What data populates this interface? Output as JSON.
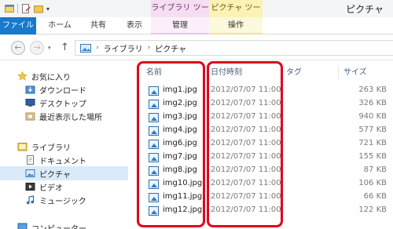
{
  "window": {
    "title": "ピクチャ"
  },
  "context_tabs": {
    "library_tools": "ライブラリ ツール",
    "picture_tools": "ピクチャ ツール"
  },
  "ribbon": {
    "file": "ファイル",
    "home": "ホーム",
    "share": "共有",
    "view": "表示",
    "manage": "管理",
    "operate": "操作"
  },
  "address": {
    "crumbs": [
      "ライブラリ",
      "ピクチャ"
    ]
  },
  "nav": {
    "favorites": "お気に入り",
    "downloads": "ダウンロード",
    "desktop": "デスクトップ",
    "recent": "最近表示した場所",
    "libraries": "ライブラリ",
    "documents": "ドキュメント",
    "pictures": "ピクチャ",
    "videos": "ビデオ",
    "music": "ミュージック",
    "computer": "コンピューター"
  },
  "columns": {
    "name": "名前",
    "date": "日付時刻",
    "tag": "タグ",
    "size": "サイズ"
  },
  "files": [
    {
      "name": "img1.jpg",
      "date": "2012/07/07 11:00",
      "size": "263 KB"
    },
    {
      "name": "img2.jpg",
      "date": "2012/07/07 11:00",
      "size": "326 KB"
    },
    {
      "name": "img3.jpg",
      "date": "2012/07/07 11:00",
      "size": "940 KB"
    },
    {
      "name": "img4.jpg",
      "date": "2012/07/07 11:00",
      "size": "577 KB"
    },
    {
      "name": "img6.jpg",
      "date": "2012/07/07 11:00",
      "size": "721 KB"
    },
    {
      "name": "img7.jpg",
      "date": "2012/07/07 11:00",
      "size": "155 KB"
    },
    {
      "name": "img8.jpg",
      "date": "2012/07/07 11:00",
      "size": "87 KB"
    },
    {
      "name": "img10.jpg",
      "date": "2012/07/07 11:00",
      "size": "106 KB"
    },
    {
      "name": "img11.jpg",
      "date": "2012/07/07 11:00",
      "size": "66 KB"
    },
    {
      "name": "img12.jpg",
      "date": "2012/07/07 11:00",
      "size": "122 KB"
    }
  ],
  "colors": {
    "accent": "#1979ca",
    "highlight": "#e2001a",
    "selection": "#d9ebfa"
  }
}
